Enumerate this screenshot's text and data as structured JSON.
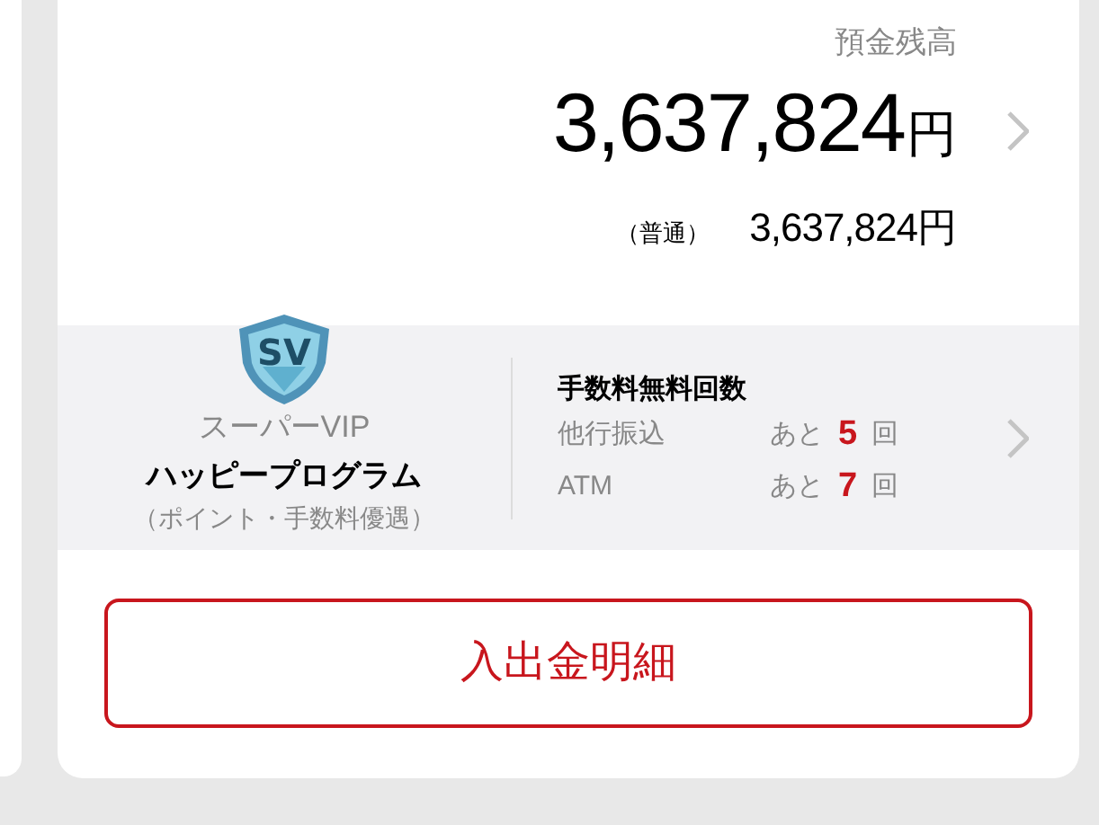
{
  "balance": {
    "label": "預金残高",
    "amount": "3,637,824",
    "unit": "円"
  },
  "accounts": [
    {
      "type": "（普通）",
      "amount": "3,637,824",
      "unit": "円"
    }
  ],
  "program": {
    "badge": "SV",
    "tier": "スーパーVIP",
    "name": "ハッピープログラム",
    "note": "（ポイント・手数料優遇）"
  },
  "fee_free": {
    "title": "手数料無料回数",
    "rows": [
      {
        "label": "他行振込",
        "prefix": "あと",
        "count": "5",
        "suffix": "回"
      },
      {
        "label": "ATM",
        "prefix": "あと",
        "count": "7",
        "suffix": "回"
      }
    ]
  },
  "button": "入出金明細"
}
